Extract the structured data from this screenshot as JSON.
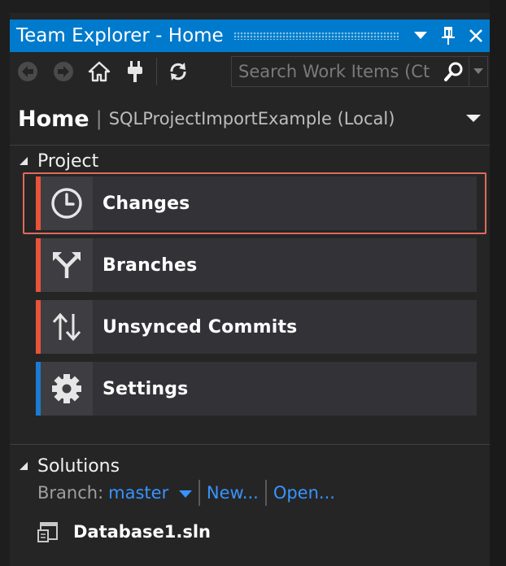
{
  "window": {
    "title": "Team Explorer - Home"
  },
  "toolbar": {
    "back_icon": "arrow-left-icon",
    "forward_icon": "arrow-right-icon",
    "home_icon": "home-icon",
    "connect_icon": "plug-icon",
    "refresh_icon": "refresh-icon"
  },
  "search": {
    "placeholder": "Search Work Items (Ct"
  },
  "header": {
    "page": "Home",
    "separator": "|",
    "project": "SQLProjectImportExample (Local)"
  },
  "project_section": {
    "label": "Project",
    "tiles": [
      {
        "label": "Changes",
        "icon": "clock-icon",
        "accent": "#e9533a"
      },
      {
        "label": "Branches",
        "icon": "branch-icon",
        "accent": "#e9533a"
      },
      {
        "label": "Unsynced Commits",
        "icon": "sync-arrows-icon",
        "accent": "#e9533a"
      },
      {
        "label": "Settings",
        "icon": "gear-icon",
        "accent": "#1b7bd1"
      }
    ]
  },
  "solutions_section": {
    "label": "Solutions",
    "branch_label": "Branch:",
    "branch_value": "master",
    "new_link": "New...",
    "open_link": "Open...",
    "solution_file": "Database1.sln"
  },
  "colors": {
    "titlebar": "#007acc",
    "panel": "#252526",
    "tile": "#333337",
    "link": "#3794ff",
    "highlight_border": "#e06b5a"
  }
}
